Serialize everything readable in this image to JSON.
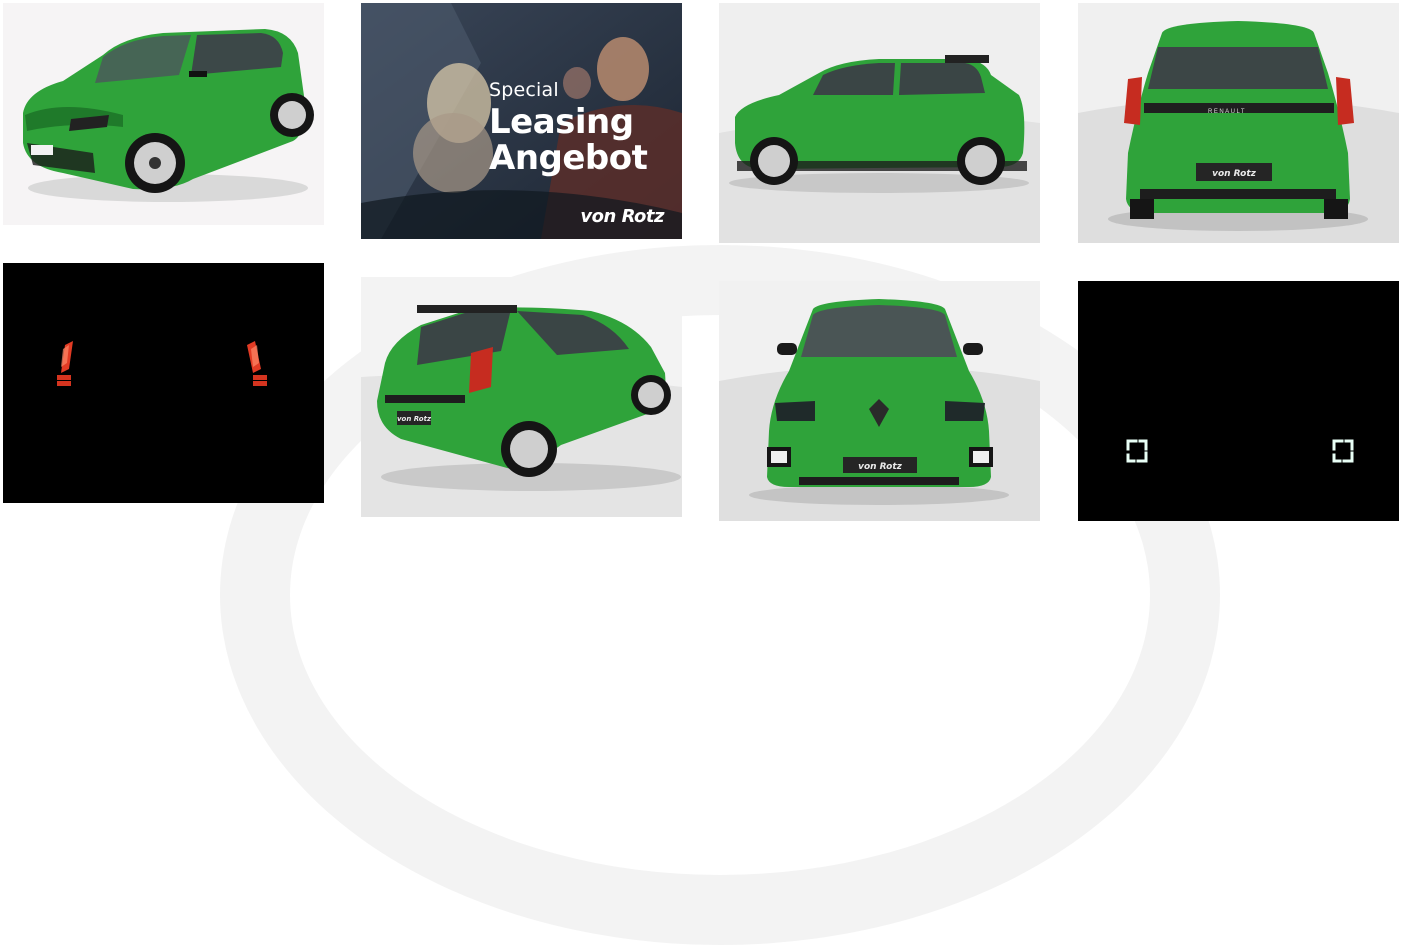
{
  "gallery": {
    "images": [
      {
        "alt": "Renault 5 green, front three-quarter view"
      },
      {
        "alt": "Special Leasing Angebot promo banner"
      },
      {
        "alt": "Renault 5 green, side profile"
      },
      {
        "alt": "Renault 5 green, rear view"
      },
      {
        "alt": "Tail lights illuminated in the dark"
      },
      {
        "alt": "Renault 5 green, rear three-quarter view"
      },
      {
        "alt": "Renault 5 green, front view"
      },
      {
        "alt": "Headlight signatures illuminated in the dark"
      }
    ]
  },
  "promo": {
    "line1": "Special",
    "line2": "Leasing",
    "line3": "Angebot",
    "brand": "von Rotz"
  },
  "car": {
    "body_color": "#2fa33a",
    "badge_rear": "RENAULT",
    "plate_text": "von Rotz"
  },
  "colors": {
    "night": "#000000",
    "studio": "#e7e7e7",
    "tail_red": "#e23b24",
    "promo_dark": "#2a3646"
  }
}
